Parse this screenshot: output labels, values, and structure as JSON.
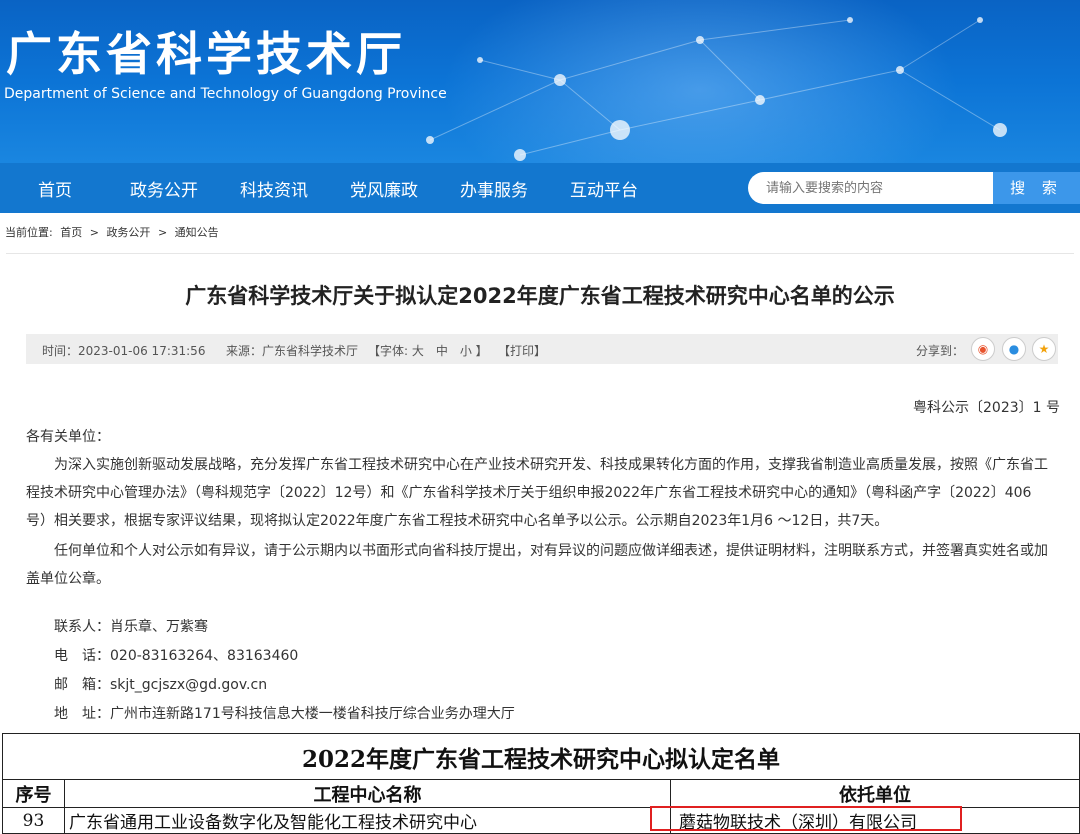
{
  "header": {
    "title": "广东省科学技术厅",
    "subtitle": "Department of Science and Technology of Guangdong Province"
  },
  "nav": {
    "items": [
      "首页",
      "政务公开",
      "科技资讯",
      "党风廉政",
      "办事服务",
      "互动平台"
    ],
    "search_placeholder": "请输入要搜索的内容",
    "search_button": "搜 索"
  },
  "breadcrumb": {
    "prefix": "当前位置:",
    "items": [
      "首页",
      ">",
      "政务公开",
      ">",
      "通知公告"
    ]
  },
  "article": {
    "title": "广东省科学技术厅关于拟认定2022年度广东省工程技术研究中心名单的公示",
    "meta": {
      "time": "时间：2023-01-06 17:31:56",
      "source": "来源：广东省科学技术厅",
      "font": "【字体: 大　中　小 】",
      "print": "【打印】",
      "share": "分享到："
    },
    "doc_no": "粤科公示〔2023〕1 号",
    "salutation": "各有关单位：",
    "para1": "为深入实施创新驱动发展战略，充分发挥广东省工程技术研究中心在产业技术研究开发、科技成果转化方面的作用，支撑我省制造业高质量发展，按照《广东省工程技术研究中心管理办法》（粤科规范字〔2022〕12号）和《广东省科学技术厅关于组织申报2022年广东省工程技术研究中心的通知》（粤科函产字〔2022〕406号）相关要求，根据专家评议结果，现将拟认定2022年度广东省工程技术研究中心名单予以公示。公示期自2023年1月6 ～12日，共7天。",
    "para2": "任何单位和个人对公示如有异议，请于公示期内以书面形式向省科技厅提出，对有异议的问题应做详细表述，提供证明材料，注明联系方式，并签署真实姓名或加盖单位公章。",
    "contact": {
      "person": "联系人：肖乐章、万紫骞",
      "phone": "电　话：020-83163264、83163460",
      "email": "邮　箱：skjt_gcjszx@gd.gov.cn",
      "address": "地　址：广州市连新路171号科技信息大楼一楼省科技厅综合业务办理大厅"
    }
  },
  "table": {
    "caption": "2022年度广东省工程技术研究中心拟认定名单",
    "headers": [
      "序号",
      "工程中心名称",
      "依托单位"
    ],
    "rows": [
      [
        "93",
        "广东省通用工业设备数字化及智能化工程技术研究中心",
        "蘑菇物联技术（深圳）有限公司"
      ]
    ]
  },
  "colors": {
    "header_blue": "#0c74d6",
    "nav_blue": "#1377cf",
    "highlight_red": "#e02020"
  }
}
